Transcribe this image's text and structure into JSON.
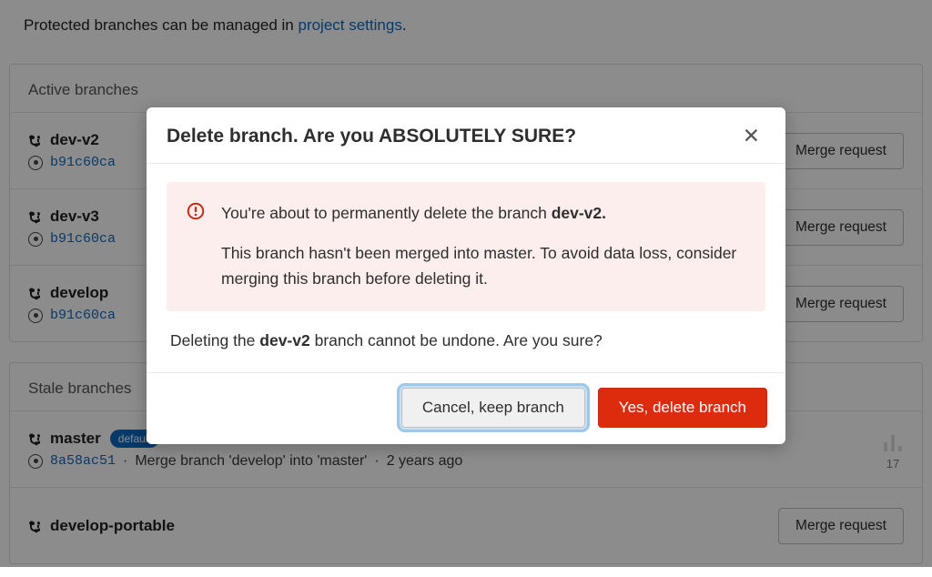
{
  "notice": {
    "prefix": "Protected branches can be managed in ",
    "link": "project settings",
    "suffix": "."
  },
  "active": {
    "title": "Active branches",
    "rows": [
      {
        "name": "dev-v2",
        "sha": "b91c60ca",
        "msg": "",
        "time": "",
        "btn": "Merge request"
      },
      {
        "name": "dev-v3",
        "sha": "b91c60ca",
        "msg": "",
        "time": "",
        "btn": "Merge request"
      },
      {
        "name": "develop",
        "sha": "b91c60ca",
        "msg": "",
        "time": "",
        "btn": "Merge request"
      }
    ]
  },
  "stale": {
    "title": "Stale branches",
    "rows": [
      {
        "name": "master",
        "badge": "default",
        "sha": "8a58ac51",
        "msg": "Merge branch 'develop' into 'master'",
        "time": "2 years ago",
        "count": "17"
      },
      {
        "name": "develop-portable",
        "sha": "",
        "msg": "",
        "time": "",
        "btn": "Merge request"
      }
    ]
  },
  "modal": {
    "title": "Delete branch. Are you ABSOLUTELY SURE?",
    "warn_line1_pre": "You're about to permanently delete the branch ",
    "warn_line1_branch": "dev-v2.",
    "warn_line2": "This branch hasn't been merged into master. To avoid data loss, consider merging this branch before deleting it.",
    "confirm_pre": "Deleting the ",
    "confirm_branch": "dev-v2",
    "confirm_post": " branch cannot be undone. Are you sure?",
    "cancel_label": "Cancel, keep branch",
    "delete_label": "Yes, delete branch"
  }
}
